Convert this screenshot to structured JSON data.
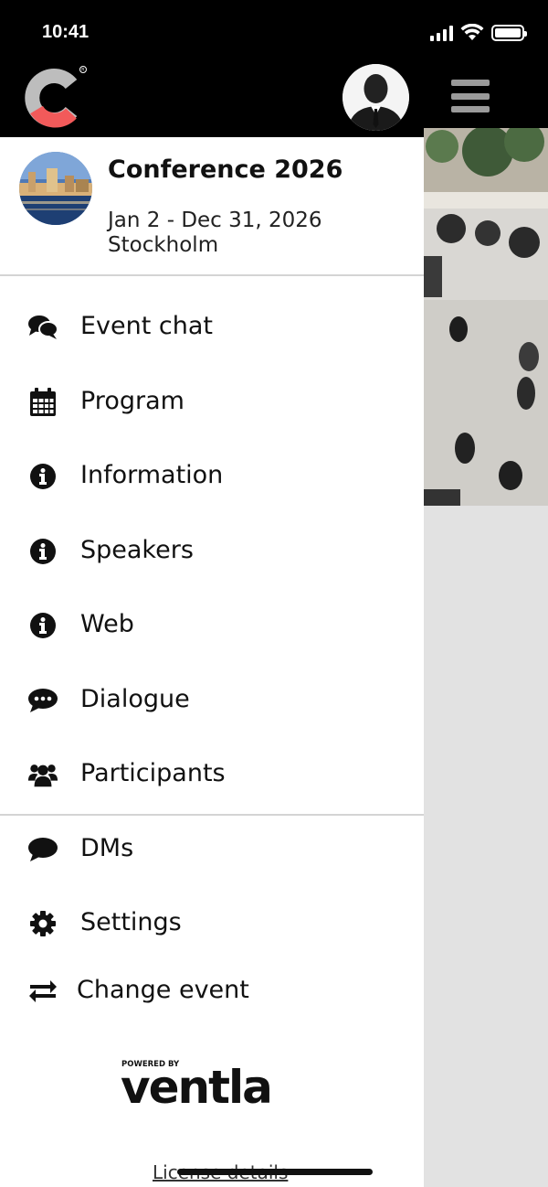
{
  "status": {
    "time": "10:41",
    "signal_icon": "signal-icon",
    "wifi_icon": "wifi-icon",
    "battery_icon": "battery-icon"
  },
  "header": {
    "logo_icon": "app-logo-icon",
    "brand_colors": {
      "logo_grey": "#bdbdbd",
      "logo_red": "#f25a5a"
    },
    "avatar_icon": "user-avatar-icon",
    "menu_icon": "hamburger-icon"
  },
  "event": {
    "title": "Conference 2026",
    "dates": "Jan 2 - Dec 31, 2026",
    "city": "Stockholm"
  },
  "menu": {
    "items": [
      {
        "label": "Event chat",
        "icon": "comments-icon"
      },
      {
        "label": "Program",
        "icon": "calendar-icon"
      },
      {
        "label": "Information",
        "icon": "info-icon"
      },
      {
        "label": "Speakers",
        "icon": "info-icon"
      },
      {
        "label": "Web",
        "icon": "info-icon"
      },
      {
        "label": "Dialogue",
        "icon": "comment-dots-icon"
      },
      {
        "label": "Participants",
        "icon": "users-icon"
      }
    ],
    "secondary": [
      {
        "label": "DMs",
        "icon": "comment-icon"
      },
      {
        "label": "Settings",
        "icon": "gear-icon"
      },
      {
        "label": "Change event",
        "icon": "exchange-icon"
      }
    ]
  },
  "footer": {
    "powered_by": "POWERED BY",
    "brand": "ventla",
    "license_link": "License details"
  }
}
